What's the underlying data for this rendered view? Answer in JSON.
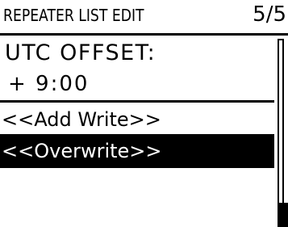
{
  "header": {
    "title": "REPEATER LIST EDIT",
    "page": "5/5"
  },
  "setting": {
    "label": "UTC OFFSET:",
    "value": "+ 9:00"
  },
  "menu": {
    "items": [
      {
        "label": "<<Add Write>>",
        "selected": false
      },
      {
        "label": "<<Overwrite>>",
        "selected": true
      }
    ]
  },
  "scroll": {
    "position_fraction": 1.0
  },
  "colors": {
    "background": "#ffffff",
    "foreground": "#000000",
    "highlight_background": "#000000",
    "highlight_text": "#ffffff"
  }
}
